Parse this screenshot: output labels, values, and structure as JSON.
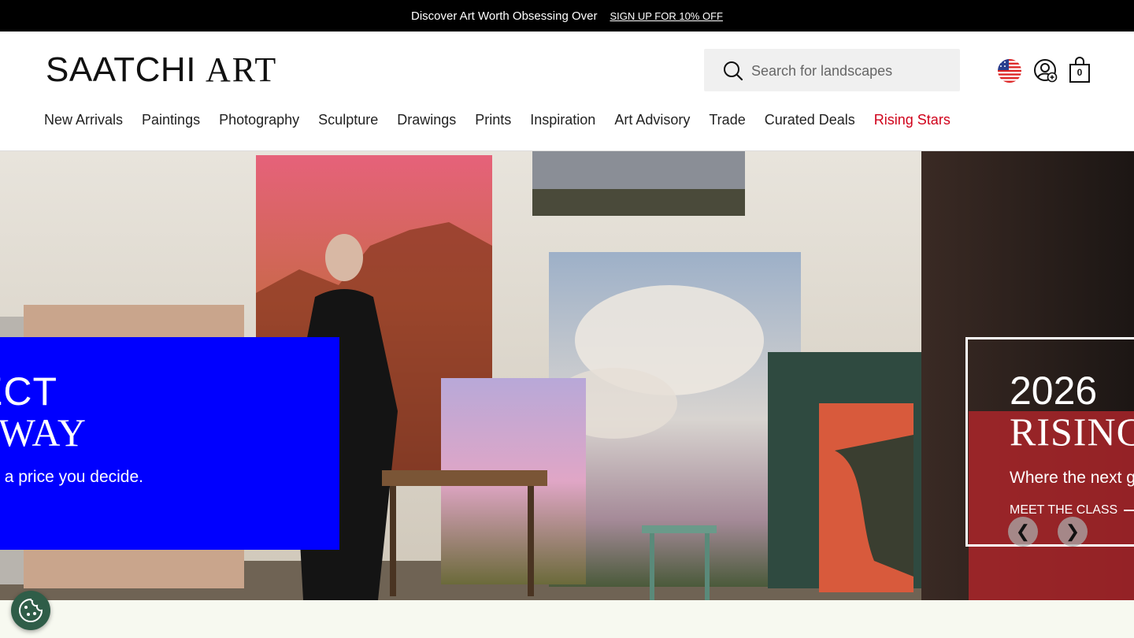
{
  "promo_bar": {
    "text": "Discover Art Worth Obsessing Over",
    "link": "SIGN UP FOR 10% OFF"
  },
  "header": {
    "logo_part1": "SAATCHI",
    "logo_part2": "ART",
    "search_placeholder": "Search for landscapes",
    "cart_count": "0"
  },
  "nav": {
    "items": [
      "New Arrivals",
      "Paintings",
      "Photography",
      "Sculpture",
      "Drawings",
      "Prints",
      "Inspiration",
      "Art Advisory",
      "Trade",
      "Curated Deals",
      "Rising Stars"
    ],
    "highlight_color": "#d0021b"
  },
  "hero": {
    "promo_card": {
      "line1": "ECT",
      "line2": "WAY",
      "subtitle": ", a price you decide.",
      "background": "#0000ff"
    },
    "rising_card": {
      "year": "2026",
      "title": "RISING",
      "tagline": "Where the next g",
      "cta": "MEET THE CLASS"
    },
    "carousel": {
      "prev": "❮",
      "next": "❯"
    }
  },
  "icons": {
    "search": "search-icon",
    "flag": "us-flag-icon",
    "account": "account-icon",
    "cart": "cart-icon",
    "cookie": "cookie-icon"
  }
}
